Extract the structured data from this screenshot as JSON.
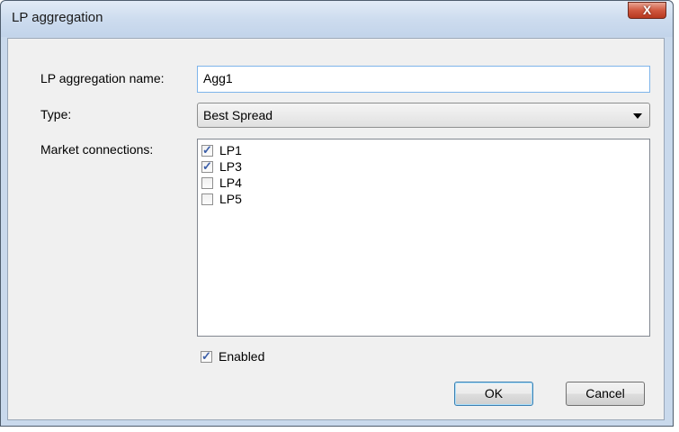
{
  "window": {
    "title": "LP aggregation",
    "close_label": "X"
  },
  "form": {
    "name_label": "LP aggregation name:",
    "name_value": "Agg1",
    "type_label": "Type:",
    "type_value": "Best Spread",
    "connections_label": "Market connections:",
    "connections": [
      {
        "label": "LP1",
        "checked": true
      },
      {
        "label": "LP3",
        "checked": true
      },
      {
        "label": "LP4",
        "checked": false
      },
      {
        "label": "LP5",
        "checked": false
      }
    ],
    "enabled_label": "Enabled",
    "enabled_checked": true
  },
  "buttons": {
    "ok_label": "OK",
    "cancel_label": "Cancel"
  }
}
